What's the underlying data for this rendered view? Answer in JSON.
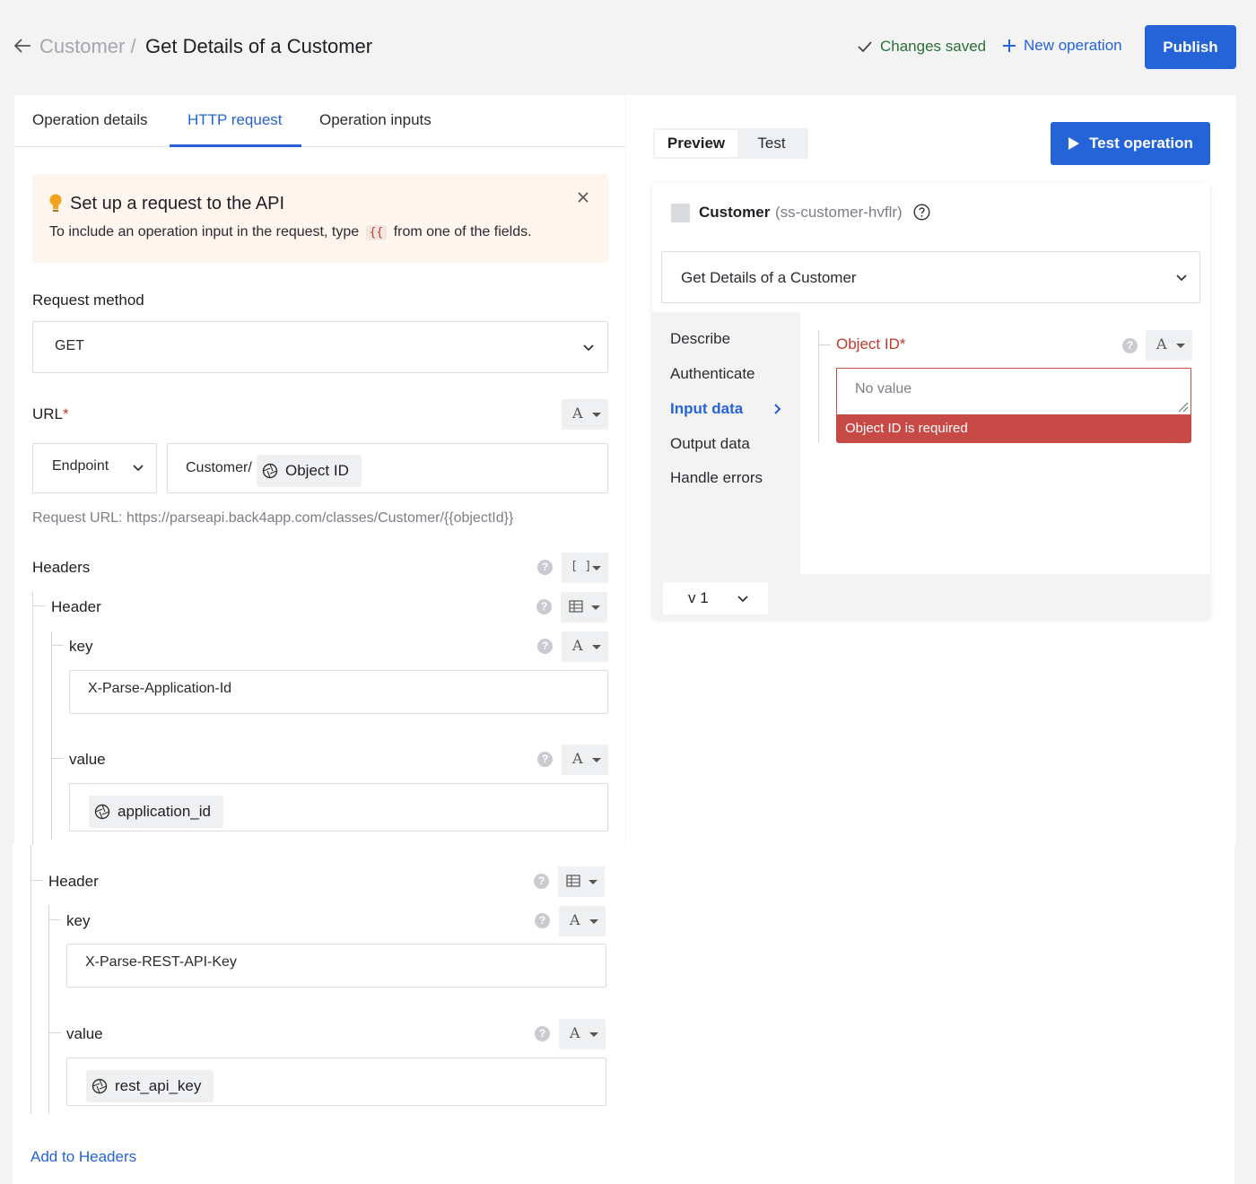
{
  "header": {
    "breadcrumb_parent": "Customer",
    "breadcrumb_sep": "/",
    "title": "Get Details of a Customer",
    "saved_status": "Changes saved",
    "new_operation": "New operation",
    "publish": "Publish"
  },
  "tabs": [
    {
      "label": "Operation details"
    },
    {
      "label": "HTTP request"
    },
    {
      "label": "Operation inputs"
    }
  ],
  "tip": {
    "title": "Set up a request to the API",
    "text_before": "To include an operation input in the request, type",
    "code": "{{",
    "text_after": "from one of the fields."
  },
  "request_method": {
    "label": "Request method",
    "value": "GET"
  },
  "url": {
    "label": "URL",
    "required_mark": "*",
    "type_glyph": "A",
    "endpoint_select": "Endpoint",
    "prefix": "Customer/",
    "chip": "Object ID",
    "request_url": "Request URL: https://parseapi.back4app.com/classes/Customer/{{objectId}}"
  },
  "headers": {
    "label": "Headers",
    "list_glyph": "[ ]",
    "items": [
      {
        "label": "Header",
        "key_label": "key",
        "key_value": "X-Parse-Application-Id",
        "value_label": "value",
        "value_chip": "application_id"
      },
      {
        "label": "Header",
        "key_label": "key",
        "key_value": "X-Parse-REST-API-Key",
        "value_label": "value",
        "value_chip": "rest_api_key"
      }
    ],
    "add_label": "Add to Headers"
  },
  "preview": {
    "segment_preview": "Preview",
    "segment_test": "Test",
    "test_operation": "Test operation",
    "connector_name": "Customer",
    "connector_id": "(ss-customer-hvflr)",
    "operation": "Get Details of a Customer",
    "nav": [
      {
        "label": "Describe"
      },
      {
        "label": "Authenticate"
      },
      {
        "label": "Input data"
      },
      {
        "label": "Output data"
      },
      {
        "label": "Handle errors"
      }
    ],
    "field_label": "Object ID",
    "field_required": "*",
    "field_placeholder": "No value",
    "field_error": "Object ID is required",
    "type_glyph": "A",
    "version": "v 1"
  },
  "colors": {
    "accent": "#2464d8",
    "error": "#c84a46",
    "saved": "#2c6e3a",
    "tip_bg": "#fdf5ee"
  }
}
